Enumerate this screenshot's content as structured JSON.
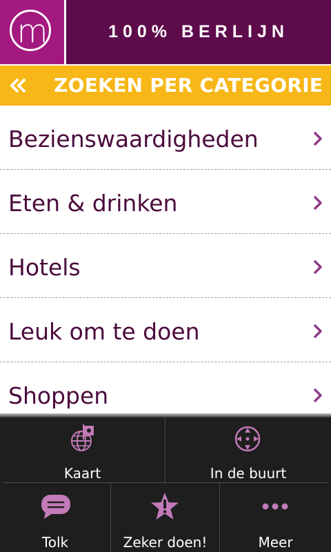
{
  "header": {
    "logo_letter": "m",
    "title": "100% BERLIJN"
  },
  "category_bar": {
    "back_icon": "double-chevron-left-icon",
    "title": "ZOEKEN PER CATEGORIE"
  },
  "categories": [
    {
      "label": "Bezienswaardigheden"
    },
    {
      "label": "Eten & drinken"
    },
    {
      "label": "Hotels"
    },
    {
      "label": "Leuk om te doen"
    },
    {
      "label": "Shoppen"
    }
  ],
  "menu": {
    "items": [
      {
        "label": "Kaart",
        "icon": "globe-map-icon"
      },
      {
        "label": "In de buurt",
        "icon": "crosshair-icon"
      },
      {
        "label": "Tolk",
        "icon": "speech-bubble-icon"
      },
      {
        "label": "Zeker doen!",
        "icon": "star-exclamation-icon"
      },
      {
        "label": "Meer",
        "icon": "more-dots-icon"
      }
    ]
  },
  "colors": {
    "header": "#5e0b4c",
    "logo": "#a3197f",
    "category_bar": "#f7b718",
    "list_text": "#4a0a3c",
    "chevron": "#8e3b88",
    "menu_bg": "#1e1e1e",
    "menu_icon": "#c27ab8"
  }
}
